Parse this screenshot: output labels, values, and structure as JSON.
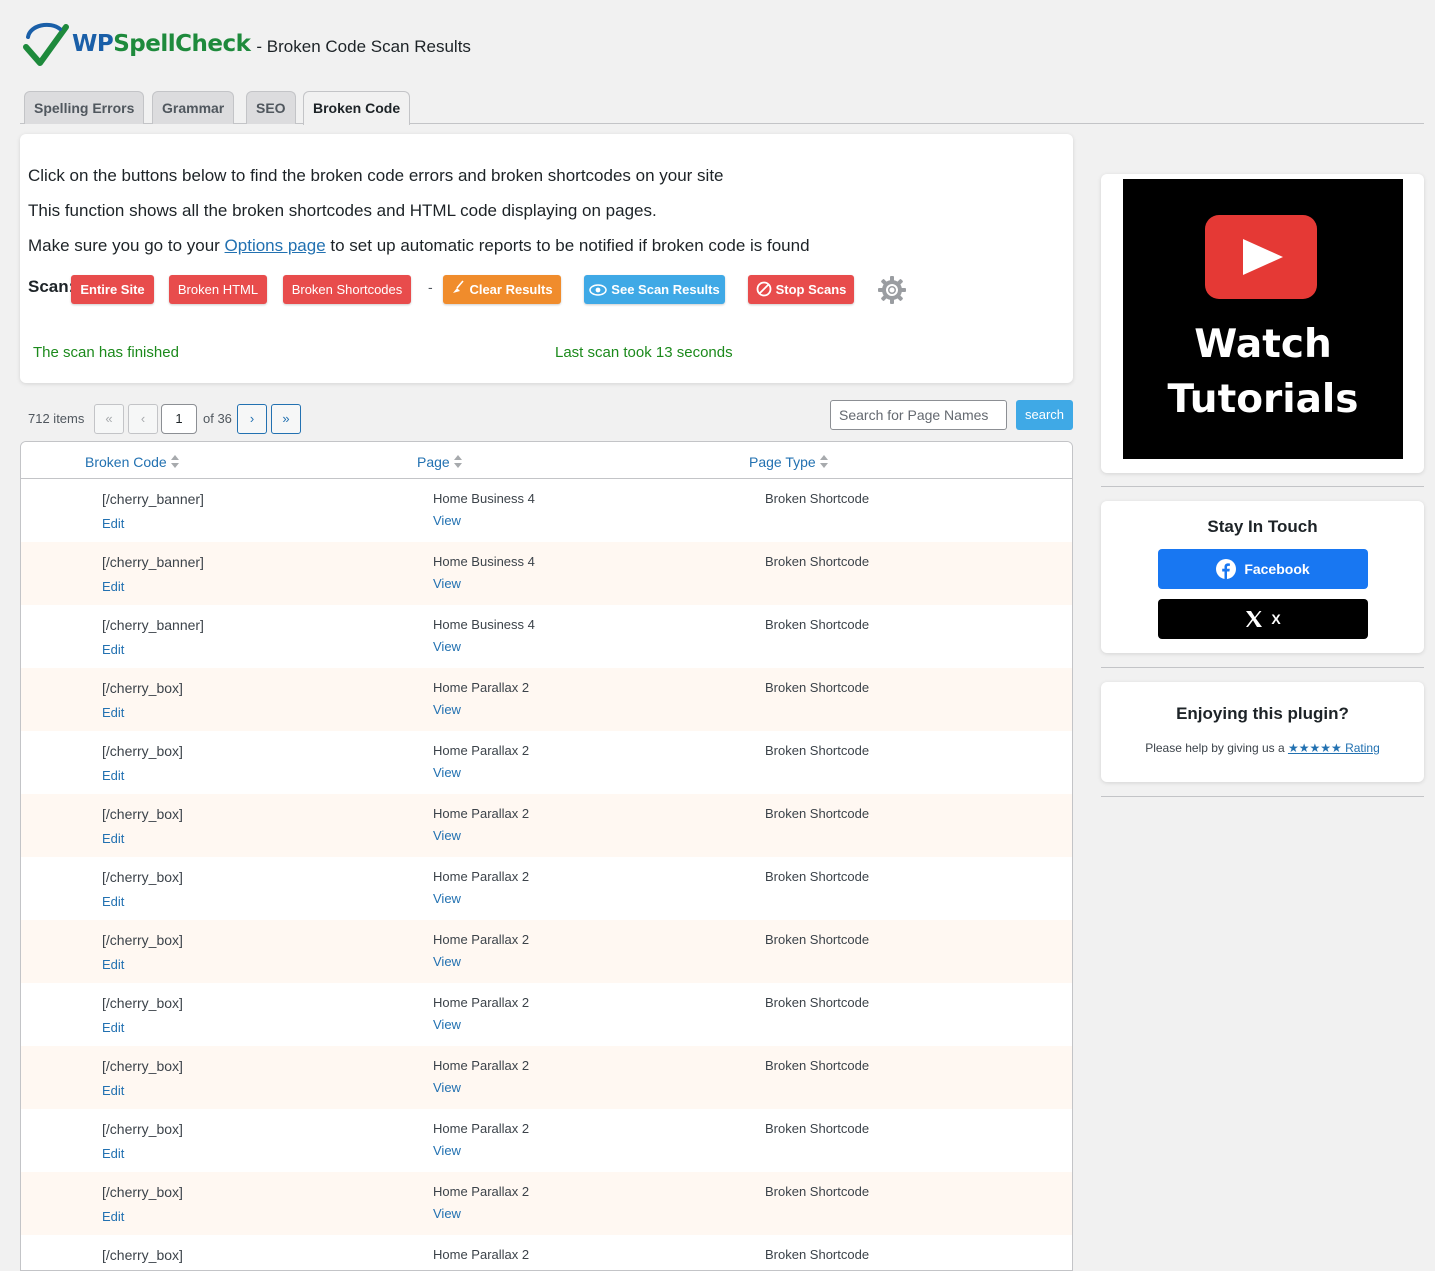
{
  "header": {
    "logo_text_prefix": "WP",
    "logo_text_suffix": "SpellCheck",
    "title": "- Broken Code Scan Results"
  },
  "tabs": [
    {
      "label": "Spelling Errors",
      "active": false
    },
    {
      "label": "Grammar",
      "active": false
    },
    {
      "label": "SEO",
      "active": false
    },
    {
      "label": "Broken Code",
      "active": true
    }
  ],
  "intro": {
    "line1": "Click on the buttons below to find the broken code errors and broken shortcodes on your site",
    "line2": "This function shows all the broken shortcodes and HTML code displaying on pages.",
    "line3_before": "Make sure you go to your ",
    "line3_link": "Options page",
    "line3_after": " to set up automatic reports to be notified if broken code is found"
  },
  "scan": {
    "label": "Scan:",
    "entire_site": "Entire Site",
    "broken_html": "Broken HTML",
    "broken_shortcodes": "Broken Shortcodes",
    "separator": "-",
    "clear_results": "Clear Results",
    "see_scan_results": "See Scan Results",
    "stop_scans": "Stop Scans",
    "status_finished": "The scan has finished",
    "status_duration": "Last scan took 13 seconds"
  },
  "pagination": {
    "items": "712 items",
    "first": "«",
    "prev": "‹",
    "current_page": "1",
    "of_text": "of 36",
    "next": "›",
    "last": "»"
  },
  "search": {
    "placeholder": "Search for Page Names",
    "button": "search"
  },
  "table": {
    "columns": [
      "Broken Code",
      "Page",
      "Page Type"
    ],
    "edit_label": "Edit",
    "view_label": "View",
    "rows": [
      {
        "code": "[/cherry_banner]",
        "page": "Home Business 4",
        "type": "Broken Shortcode"
      },
      {
        "code": "[/cherry_banner]",
        "page": "Home Business 4",
        "type": "Broken Shortcode"
      },
      {
        "code": "[/cherry_banner]",
        "page": "Home Business 4",
        "type": "Broken Shortcode"
      },
      {
        "code": "[/cherry_box]",
        "page": "Home Parallax 2",
        "type": "Broken Shortcode"
      },
      {
        "code": "[/cherry_box]",
        "page": "Home Parallax 2",
        "type": "Broken Shortcode"
      },
      {
        "code": "[/cherry_box]",
        "page": "Home Parallax 2",
        "type": "Broken Shortcode"
      },
      {
        "code": "[/cherry_box]",
        "page": "Home Parallax 2",
        "type": "Broken Shortcode"
      },
      {
        "code": "[/cherry_box]",
        "page": "Home Parallax 2",
        "type": "Broken Shortcode"
      },
      {
        "code": "[/cherry_box]",
        "page": "Home Parallax 2",
        "type": "Broken Shortcode"
      },
      {
        "code": "[/cherry_box]",
        "page": "Home Parallax 2",
        "type": "Broken Shortcode"
      },
      {
        "code": "[/cherry_box]",
        "page": "Home Parallax 2",
        "type": "Broken Shortcode"
      },
      {
        "code": "[/cherry_box]",
        "page": "Home Parallax 2",
        "type": "Broken Shortcode"
      },
      {
        "code": "[/cherry_box]",
        "page": "Home Parallax 2",
        "type": "Broken Shortcode"
      }
    ]
  },
  "sidebar": {
    "video_line1": "Watch",
    "video_line2": "Tutorials",
    "stay_title": "Stay In Touch",
    "facebook": "Facebook",
    "x": "X",
    "enjoy_title": "Enjoying this plugin?",
    "rate_before": "Please help by giving us a ",
    "rate_link": "★★★★★ Rating"
  },
  "colors": {
    "accent_link": "#2271b1",
    "scan_red": "#e84c4c",
    "clear_orange": "#f08c2c",
    "results_blue": "#3fa9e6",
    "status_green": "#1c8a1c",
    "facebook_blue": "#1877f2",
    "x_black": "#000000",
    "youtube_red": "#e53935"
  }
}
